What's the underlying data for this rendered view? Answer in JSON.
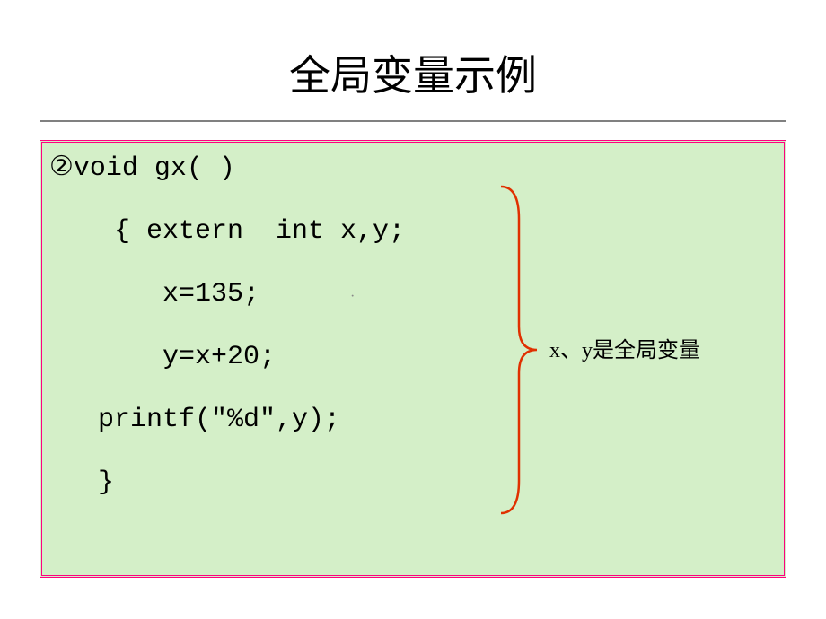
{
  "title": "全局变量示例",
  "code": {
    "marker": "②",
    "line1": "void gx( )",
    "line2": "    { extern  int x,y;",
    "line3": "       x=135;",
    "line4": "       y=x+20;",
    "line5": "   printf(\"%d\",y);",
    "line6": "   }"
  },
  "annotation": "x、y是全局变量",
  "dot": "·"
}
